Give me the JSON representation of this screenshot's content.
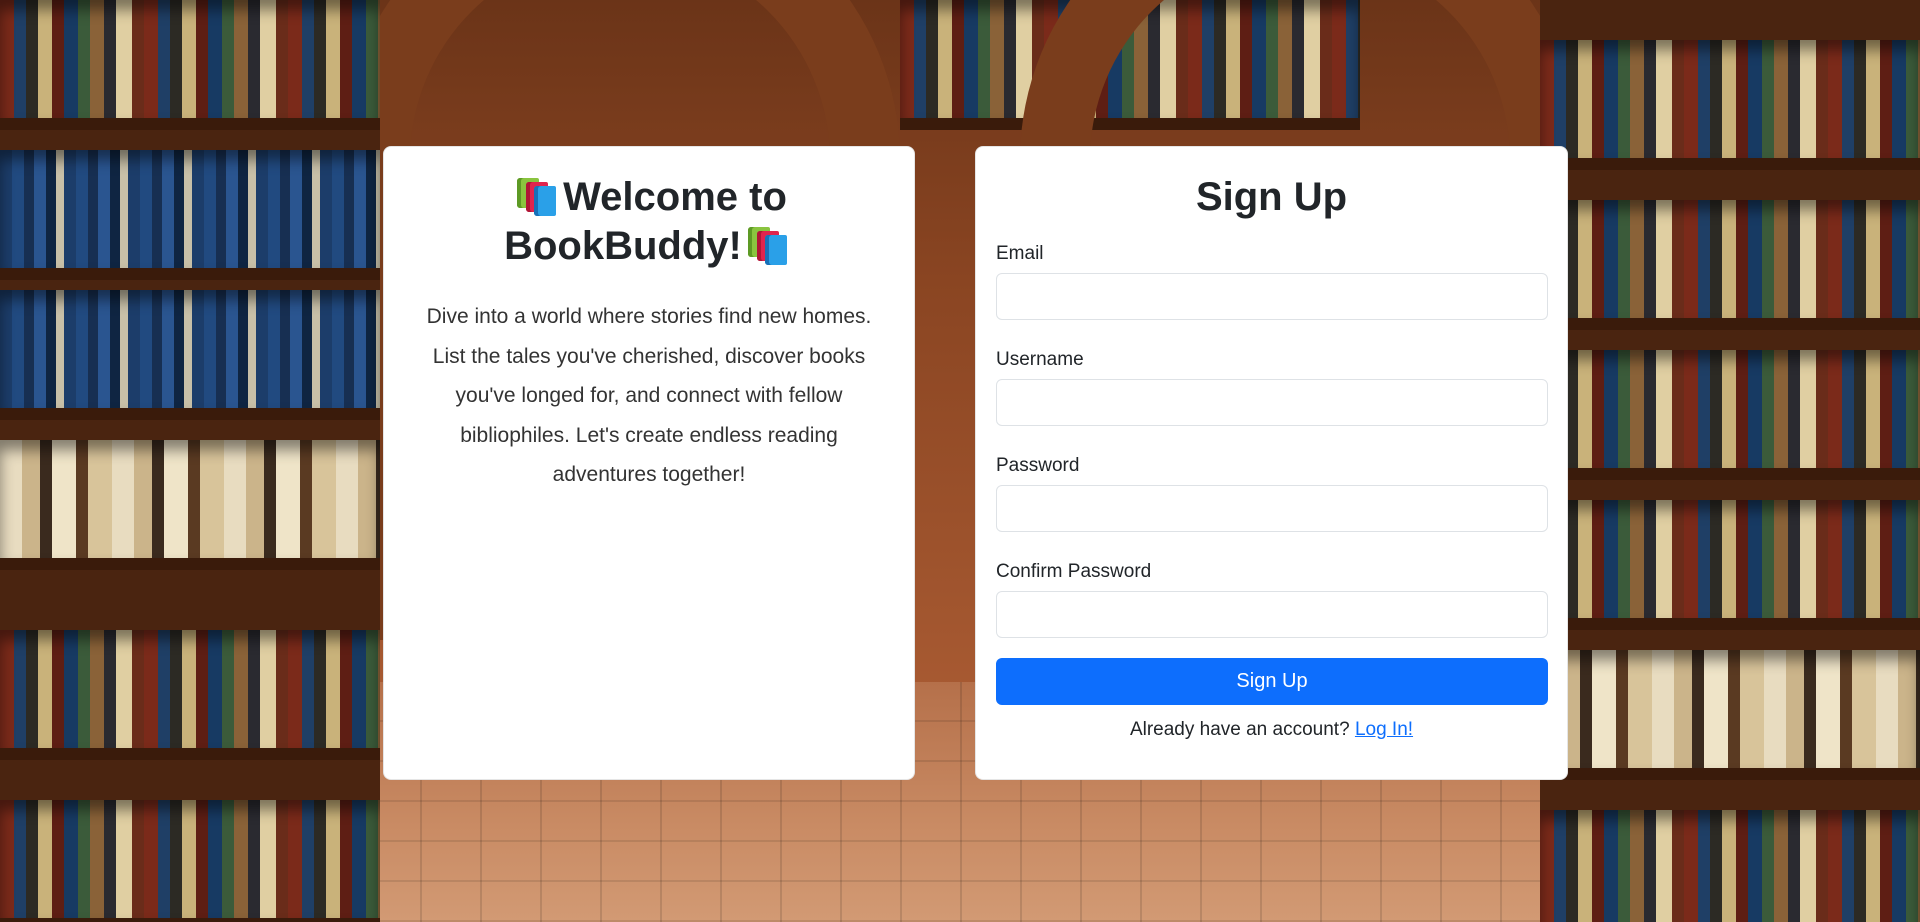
{
  "welcome": {
    "title_line1": "Welcome to",
    "title_line2": "BookBuddy!",
    "decor_icon": "books-icon",
    "text": "Dive into a world where stories find new homes. List the tales you've cherished, discover books you've longed for, and connect with fellow bibliophiles. Let's create endless reading adventures together!"
  },
  "signup": {
    "title": "Sign Up",
    "fields": [
      {
        "label": "Email",
        "value": "",
        "placeholder": ""
      },
      {
        "label": "Username",
        "value": "",
        "placeholder": ""
      },
      {
        "label": "Password",
        "value": "",
        "placeholder": ""
      },
      {
        "label": "Confirm Password",
        "value": "",
        "placeholder": ""
      }
    ],
    "button_label": "Sign Up",
    "login_prompt": "Already have an account?",
    "login_link": "Log In!"
  },
  "colors": {
    "accent": "#0d6efd",
    "card_bg": "#ffffff",
    "text": "#212529"
  },
  "background": {
    "scene": "library-bookshelves-archway"
  }
}
